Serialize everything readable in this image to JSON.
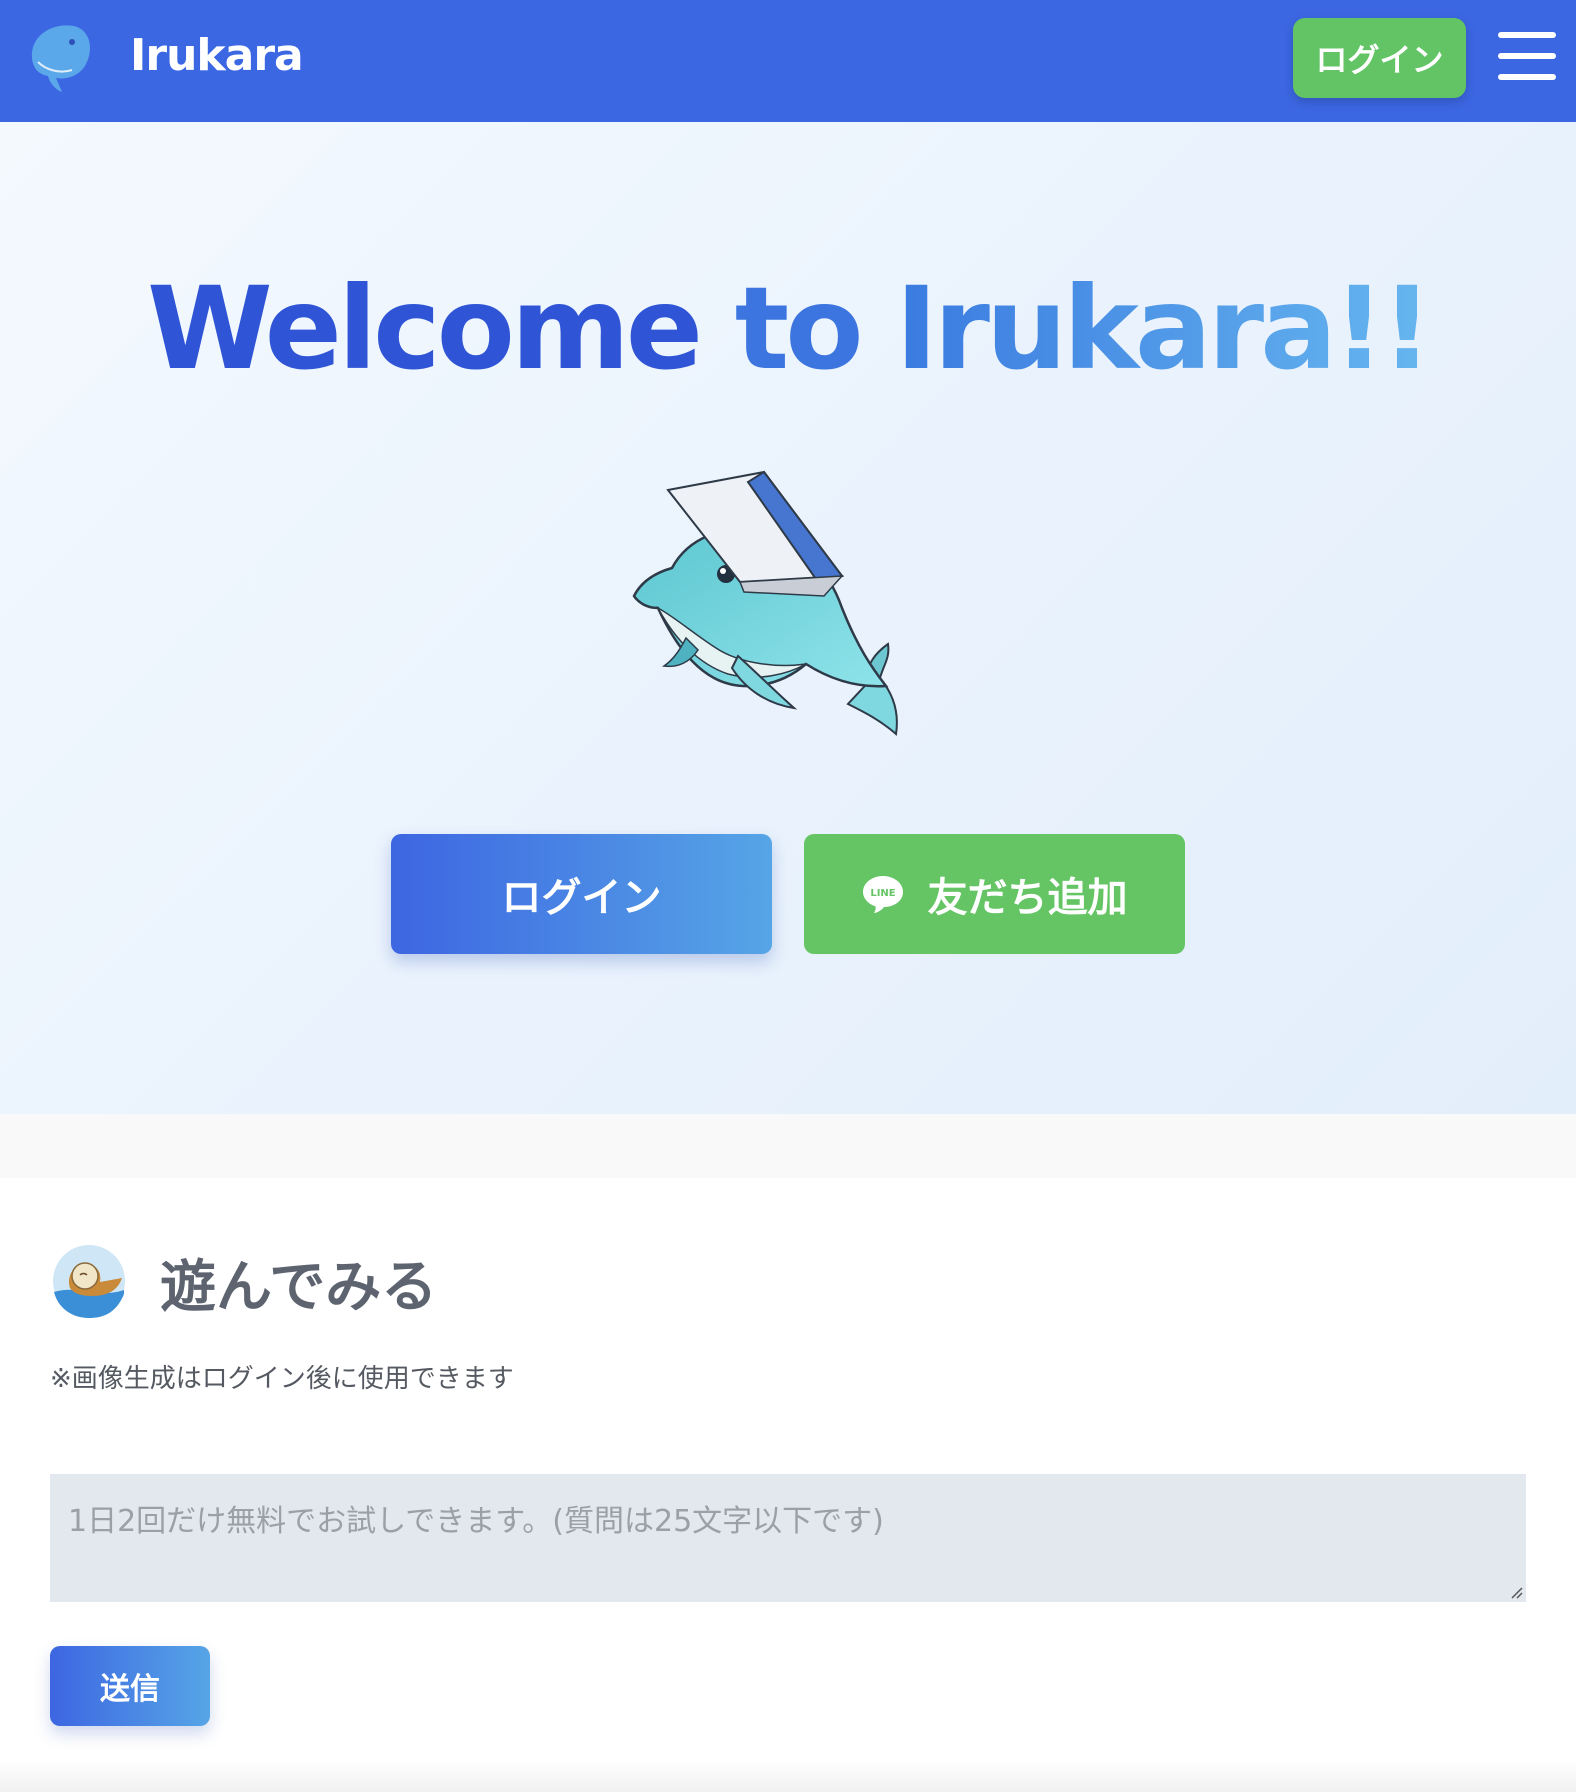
{
  "header": {
    "brand": "Irukara",
    "login_label": "ログイン",
    "logo_icon": "dolphin-logo-icon",
    "menu_icon": "hamburger-menu-icon"
  },
  "hero": {
    "title_part1": "Welcome",
    "title_part2": "to",
    "title_part3": "Irukara!!",
    "mascot": "dolphin-mascot-with-book",
    "login_label": "ログイン",
    "line_label": "友だち追加",
    "line_icon": "line-icon"
  },
  "play": {
    "avatar": "dolphin-avatar-icon",
    "title": "遊んでみる",
    "note": "※画像生成はログイン後に使用できます",
    "input_placeholder": "1日2回だけ無料でお試しできます。(質問は25文字以下です)",
    "input_value": "",
    "send_label": "送信"
  },
  "colors": {
    "header_bg": "#3c67e3",
    "green": "#65c565",
    "blue_gradient_start": "#3d66e2",
    "blue_gradient_end": "#56a5e6"
  }
}
